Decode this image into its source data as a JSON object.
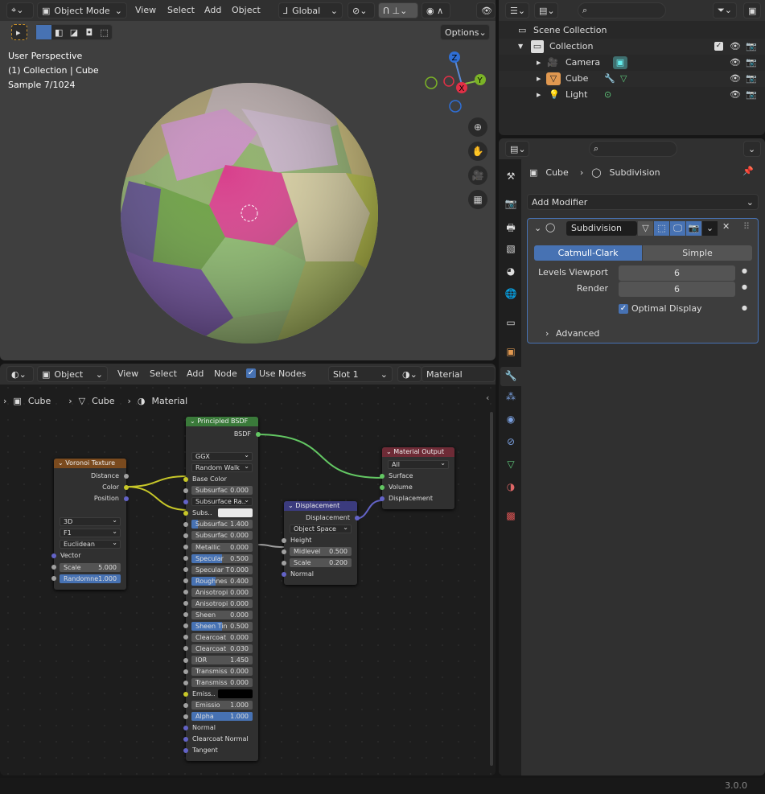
{
  "viewport": {
    "header": {
      "mode": "Object Mode",
      "menus": [
        "View",
        "Select",
        "Add",
        "Object"
      ],
      "orientation": "Global",
      "options": "Options"
    },
    "overlay_text": [
      "User Perspective",
      "(1) Collection | Cube",
      "Sample 7/1024"
    ],
    "gizmo": {
      "z": "Z",
      "y": "Y",
      "x": "X"
    }
  },
  "node_editor": {
    "header": {
      "object": "Object",
      "menus": [
        "View",
        "Select",
        "Add",
        "Node"
      ],
      "use_nodes": "Use Nodes",
      "use_nodes_checked": true,
      "slot": "Slot 1",
      "material": "Material"
    },
    "breadcrumb": [
      "Cube",
      "Cube",
      "Material"
    ],
    "nodes": {
      "voronoi": {
        "title": "Voronoi Texture",
        "color": "#7a4a1e",
        "rows": [
          {
            "k": "out",
            "label": "Distance",
            "sock": "#a1a1a1"
          },
          {
            "k": "out",
            "label": "Color",
            "sock": "#c7c729"
          },
          {
            "k": "out",
            "label": "Position",
            "sock": "#6363c7"
          },
          {
            "k": "gap"
          },
          {
            "k": "sel",
            "label": "3D"
          },
          {
            "k": "sel",
            "label": "F1"
          },
          {
            "k": "sel",
            "label": "Euclidean"
          },
          {
            "k": "in",
            "label": "Vector",
            "sock": "#6363c7"
          },
          {
            "k": "fld",
            "label": "Scale",
            "value": "5.000",
            "sock": "#a1a1a1",
            "fill": 0
          },
          {
            "k": "fld",
            "label": "Randomne",
            "value": "1.000",
            "sock": "#a1a1a1",
            "fill": 1
          }
        ]
      },
      "principled": {
        "title": "Principled BSDF",
        "color": "#3a7a3a",
        "rows": [
          {
            "k": "out",
            "label": "BSDF",
            "sock": "#63c763"
          },
          {
            "k": "gap"
          },
          {
            "k": "sel",
            "label": "GGX"
          },
          {
            "k": "sel",
            "label": "Random Walk"
          },
          {
            "k": "in",
            "label": "Base Color",
            "sock": "#c7c729"
          },
          {
            "k": "fld",
            "label": "Subsurfac",
            "value": "0.000",
            "sock": "#a1a1a1",
            "fill": 0
          },
          {
            "k": "sel",
            "label": "Subsurface Ra..",
            "sock": "#6363c7"
          },
          {
            "k": "col",
            "label": "Subs..",
            "swatch": "#e8e8e8",
            "sock": "#c7c729"
          },
          {
            "k": "fld",
            "label": "Subsurfac",
            "value": "1.400",
            "sock": "#a1a1a1",
            "fill": 0.1
          },
          {
            "k": "fld",
            "label": "Subsurfac",
            "value": "0.000",
            "sock": "#a1a1a1",
            "fill": 0
          },
          {
            "k": "fld",
            "label": "Metallic",
            "value": "0.000",
            "sock": "#a1a1a1",
            "fill": 0
          },
          {
            "k": "fld",
            "label": "Specular",
            "value": "0.500",
            "sock": "#a1a1a1",
            "fill": 0.5
          },
          {
            "k": "fld",
            "label": "Specular T",
            "value": "0.000",
            "sock": "#a1a1a1",
            "fill": 0
          },
          {
            "k": "fld",
            "label": "Roughnes",
            "value": "0.400",
            "sock": "#a1a1a1",
            "fill": 0.4
          },
          {
            "k": "fld",
            "label": "Anisotropi",
            "value": "0.000",
            "sock": "#a1a1a1",
            "fill": 0
          },
          {
            "k": "fld",
            "label": "Anisotropi",
            "value": "0.000",
            "sock": "#a1a1a1",
            "fill": 0
          },
          {
            "k": "fld",
            "label": "Sheen",
            "value": "0.000",
            "sock": "#a1a1a1",
            "fill": 0
          },
          {
            "k": "fld",
            "label": "Sheen Tin",
            "value": "0.500",
            "sock": "#a1a1a1",
            "fill": 0.5
          },
          {
            "k": "fld",
            "label": "Clearcoat",
            "value": "0.000",
            "sock": "#a1a1a1",
            "fill": 0
          },
          {
            "k": "fld",
            "label": "Clearcoat",
            "value": "0.030",
            "sock": "#a1a1a1",
            "fill": 0
          },
          {
            "k": "fld",
            "label": "IOR",
            "value": "1.450",
            "sock": "#a1a1a1",
            "fill": 0
          },
          {
            "k": "fld",
            "label": "Transmiss",
            "value": "0.000",
            "sock": "#a1a1a1",
            "fill": 0
          },
          {
            "k": "fld",
            "label": "Transmiss",
            "value": "0.000",
            "sock": "#a1a1a1",
            "fill": 0
          },
          {
            "k": "col",
            "label": "Emiss..",
            "swatch": "#000000",
            "sock": "#c7c729"
          },
          {
            "k": "fld",
            "label": "Emissio",
            "value": "1.000",
            "sock": "#a1a1a1",
            "fill": 0
          },
          {
            "k": "fld",
            "label": "Alpha",
            "value": "1.000",
            "sock": "#a1a1a1",
            "fill": 1
          },
          {
            "k": "in",
            "label": "Normal",
            "sock": "#6363c7"
          },
          {
            "k": "in",
            "label": "Clearcoat Normal",
            "sock": "#6363c7"
          },
          {
            "k": "in",
            "label": "Tangent",
            "sock": "#6363c7"
          }
        ]
      },
      "displacement": {
        "title": "Displacement",
        "color": "#3b3b7e",
        "rows": [
          {
            "k": "out",
            "label": "Displacement",
            "sock": "#6363c7"
          },
          {
            "k": "sel",
            "label": "Object Space"
          },
          {
            "k": "in",
            "label": "Height",
            "sock": "#a1a1a1"
          },
          {
            "k": "fld",
            "label": "Midlevel",
            "value": "0.500",
            "sock": "#a1a1a1",
            "fill": 0
          },
          {
            "k": "fld",
            "label": "Scale",
            "value": "0.200",
            "sock": "#a1a1a1",
            "fill": 0
          },
          {
            "k": "in",
            "label": "Normal",
            "sock": "#6363c7"
          }
        ]
      },
      "output": {
        "title": "Material Output",
        "color": "#6e2b36",
        "rows": [
          {
            "k": "sel",
            "label": "All"
          },
          {
            "k": "in",
            "label": "Surface",
            "sock": "#63c763"
          },
          {
            "k": "in",
            "label": "Volume",
            "sock": "#63c763"
          },
          {
            "k": "in",
            "label": "Displacement",
            "sock": "#6363c7"
          }
        ]
      }
    }
  },
  "outliner": {
    "root": "Scene Collection",
    "collection": "Collection",
    "items": [
      {
        "label": "Camera"
      },
      {
        "label": "Cube"
      },
      {
        "label": "Light"
      }
    ]
  },
  "properties": {
    "breadcrumb": [
      "Cube",
      "Subdivision"
    ],
    "add_modifier": "Add Modifier",
    "modifier": {
      "name": "Subdivision",
      "type_options": [
        "Catmull-Clark",
        "Simple"
      ],
      "type_selected": "Catmull-Clark",
      "levels_viewport_label": "Levels Viewport",
      "levels_viewport": "6",
      "render_label": "Render",
      "render": "6",
      "optimal_display": "Optimal Display",
      "optimal_display_checked": true,
      "advanced": "Advanced"
    }
  },
  "status": {
    "version": "3.0.0"
  },
  "colors": {
    "accent": "#4772b3",
    "selected_outline": "#4772b3"
  }
}
